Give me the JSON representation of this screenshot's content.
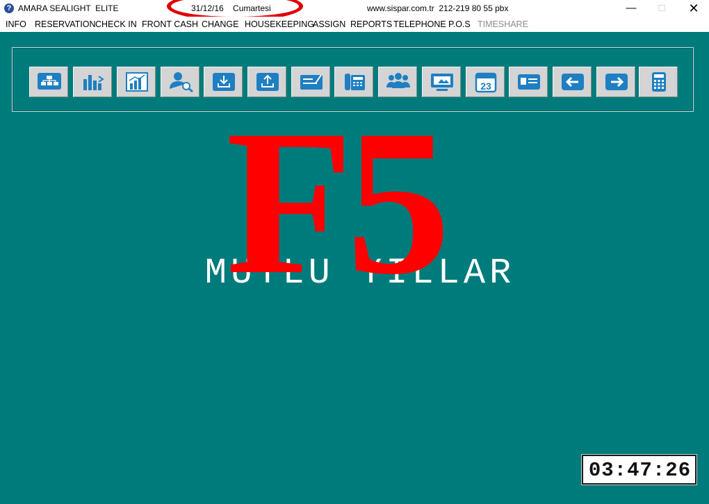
{
  "titlebar": {
    "app_title": "AMARA SEALIGHT  ELITE",
    "date": "31/12/16    Cumartesi",
    "website": "www.sispar.com.tr  212-219 80 55 pbx",
    "minimize": "—",
    "maximize": "□",
    "close": "✕"
  },
  "menu": {
    "items": [
      "INFO",
      "RESERVATION",
      "CHECK IN",
      "FRONT CASH",
      "CHANGE",
      "HOUSEKEEPING",
      "ASSIGN",
      "REPORTS",
      "TELEPHONE",
      "P.O.S"
    ],
    "disabled_item": "TIMESHARE"
  },
  "toolbar": {
    "buttons": [
      "room-rack-icon",
      "occupancy-chart-icon",
      "statistics-chart-icon",
      "guest-search-icon",
      "download-icon",
      "upload-icon",
      "cheque-icon",
      "phone-icon",
      "guests-group-icon",
      "screen-icon",
      "calendar-icon",
      "guest-card-icon",
      "arrow-left-icon",
      "arrow-right-icon",
      "calculator-icon"
    ],
    "calendar_day": "23"
  },
  "main": {
    "greeting": "MUTLU YILLAR",
    "overlay_label": "F5",
    "clock": "03:47:26"
  },
  "colors": {
    "background": "#007b7b",
    "annotation_red": "#ff0000",
    "icon_blue": "#1e7fc2"
  }
}
